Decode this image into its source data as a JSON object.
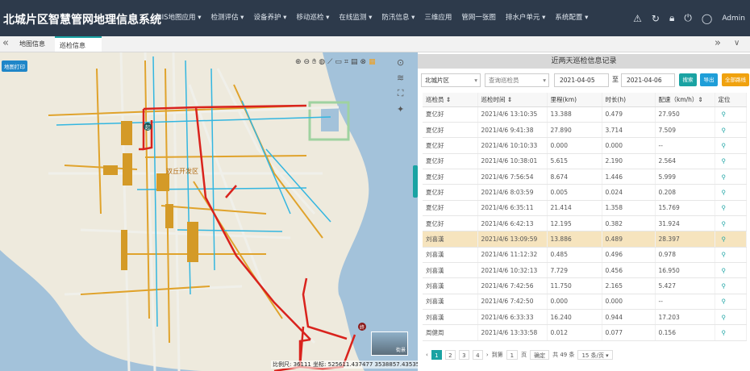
{
  "app": {
    "title": "北城片区智慧管网地理信息系统"
  },
  "menu": [
    "GIS地图应用 ▾",
    "检测评估 ▾",
    "设备养护 ▾",
    "移动巡检 ▾",
    "在线监测 ▾",
    "防汛信息 ▾",
    "三维应用",
    "管网一张图",
    "排水户单元 ▾",
    "系统配置 ▾"
  ],
  "user": {
    "name": "Admin"
  },
  "tabs": {
    "left_nav": "«",
    "right_nav": "»",
    "dropdown": "∨",
    "map_tab": "地图信息",
    "patrol_tab": "巡检信息",
    "close": "×"
  },
  "map": {
    "print_button": "地图打印",
    "district_label": "双丘开发区",
    "start_marker": "起",
    "end_marker": "终",
    "scale_text": "比例尺: 36111  坐标: 525611.437477 3538857.43535",
    "street_view_label": "街景"
  },
  "panel": {
    "title": "近两天巡检信息记录",
    "district": "北城片区",
    "inspector_placeholder": "查询巡检员",
    "date_from": "2021-04-05",
    "date_sep": "至",
    "date_to": "2021-04-06",
    "search_label": "搜索",
    "export_label": "导出",
    "all_routes_label": "全部路线",
    "colors": {
      "search": "#1aa3a3",
      "export": "#1f9ed8",
      "all_routes": "#f0a20f"
    }
  },
  "table": {
    "headers": [
      "巡检员 ⇕",
      "巡检时间 ⇕",
      "里程(km)",
      "时长(h)",
      "配速（km/h）⇕",
      "定位"
    ],
    "rows": [
      [
        "夏亿好",
        "2021/4/6 13:10:35",
        "13.388",
        "0.479",
        "27.950"
      ],
      [
        "夏亿好",
        "2021/4/6 9:41:38",
        "27.890",
        "3.714",
        "7.509"
      ],
      [
        "夏亿好",
        "2021/4/6 10:10:33",
        "0.000",
        "0.000",
        "--"
      ],
      [
        "夏亿好",
        "2021/4/6 10:38:01",
        "5.615",
        "2.190",
        "2.564"
      ],
      [
        "夏亿好",
        "2021/4/6 7:56:54",
        "8.674",
        "1.446",
        "5.999"
      ],
      [
        "夏亿好",
        "2021/4/6 8:03:59",
        "0.005",
        "0.024",
        "0.208"
      ],
      [
        "夏亿好",
        "2021/4/6 6:35:11",
        "21.414",
        "1.358",
        "15.769"
      ],
      [
        "夏亿好",
        "2021/4/6 6:42:13",
        "12.195",
        "0.382",
        "31.924"
      ],
      [
        "刘喜漢",
        "2021/4/6 13:09:59",
        "13.886",
        "0.489",
        "28.397"
      ],
      [
        "刘喜漢",
        "2021/4/6 11:12:32",
        "0.485",
        "0.496",
        "0.978"
      ],
      [
        "刘喜漢",
        "2021/4/6 10:32:13",
        "7.729",
        "0.456",
        "16.950"
      ],
      [
        "刘喜漢",
        "2021/4/6 7:42:56",
        "11.750",
        "2.165",
        "5.427"
      ],
      [
        "刘喜漢",
        "2021/4/6 7:42:50",
        "0.000",
        "0.000",
        "--"
      ],
      [
        "刘喜漢",
        "2021/4/6 6:33:33",
        "16.240",
        "0.944",
        "17.203"
      ],
      [
        "周健周",
        "2021/4/6 13:33:58",
        "0.012",
        "0.077",
        "0.156"
      ]
    ],
    "highlight_row": 8,
    "locate_icon": "map-pin-icon"
  },
  "pager": {
    "prev": "‹",
    "pages": [
      "1",
      "2",
      "3",
      "4"
    ],
    "next": "›",
    "goto_label": "到第",
    "page_input": "1",
    "page_suffix": "页",
    "confirm_label": "确定",
    "total_label": "共 49 条",
    "page_size": "15 条/页 ▾"
  }
}
